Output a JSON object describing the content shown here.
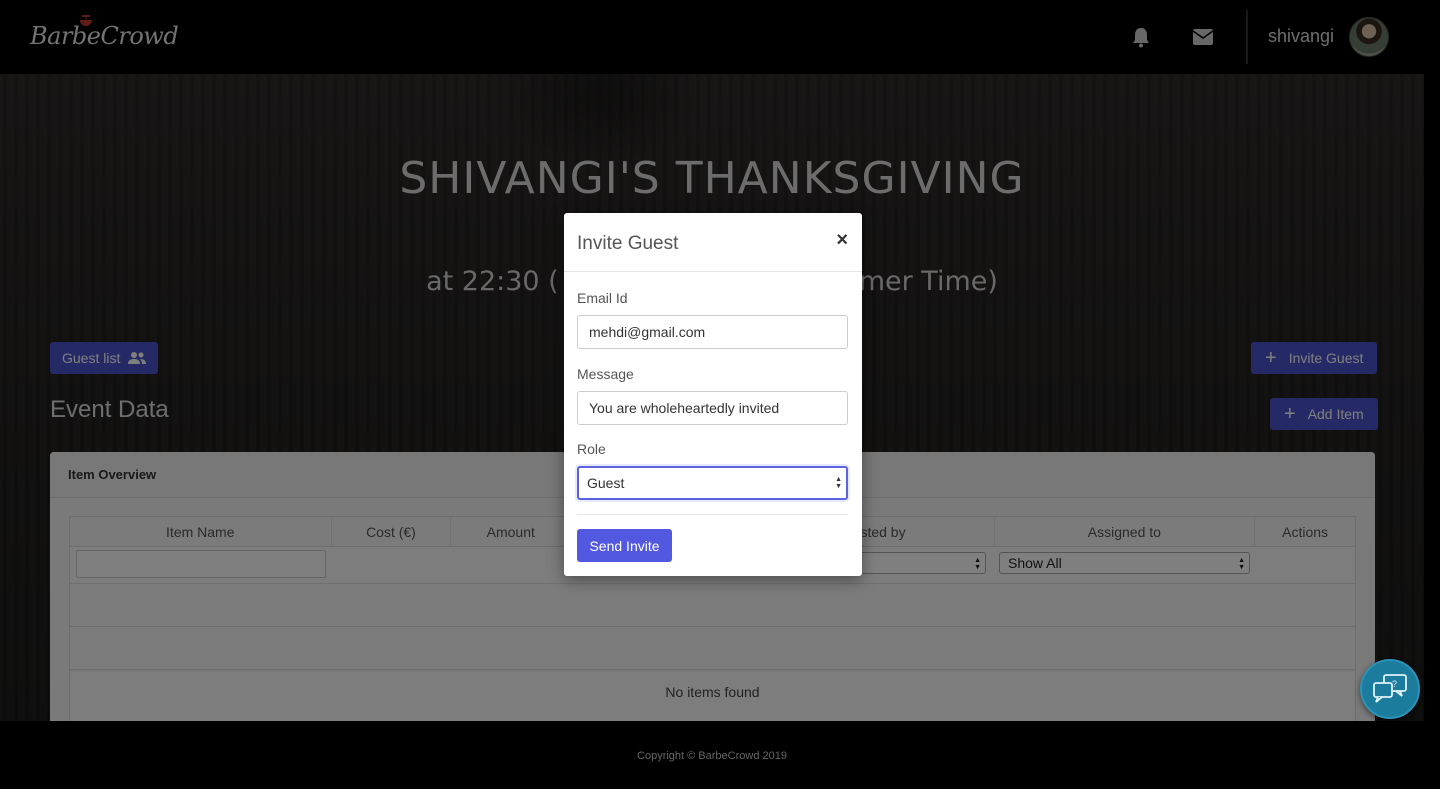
{
  "navbar": {
    "logo": "BarbeCrowd",
    "username": "shivangi",
    "icons": [
      "bell-icon",
      "envelope-icon"
    ]
  },
  "hero": {
    "title": "SHIVANGI'S THANKSGIVING",
    "subtitle_left": "at 22:30 (",
    "subtitle_right": "mer Time)"
  },
  "buttons": {
    "guest_list": "Guest list",
    "invite_guest": "Invite Guest",
    "add_item": "Add Item"
  },
  "section": {
    "title": "Event Data",
    "card_header": "Item Overview"
  },
  "table": {
    "columns": [
      "Item Name",
      "Cost (€)",
      "Amount",
      "sted by",
      "Assigned to",
      "Actions"
    ],
    "filter_select_left": "",
    "filter_select_right": "Show All",
    "empty_text": "No items found"
  },
  "modal": {
    "title": "Invite Guest",
    "close": "×",
    "email_label": "Email Id",
    "email_value": "mehdi@gmail.com",
    "message_label": "Message",
    "message_value": "You are wholeheartedly invited",
    "role_label": "Role",
    "role_value": "Guest",
    "send_label": "Send Invite"
  },
  "footer": {
    "copyright": "Copyright © BarbeCrowd 2019"
  },
  "colors": {
    "accent": "#5259e0",
    "nav_bg": "#000000",
    "chat_fab": "#1b7c9e"
  }
}
